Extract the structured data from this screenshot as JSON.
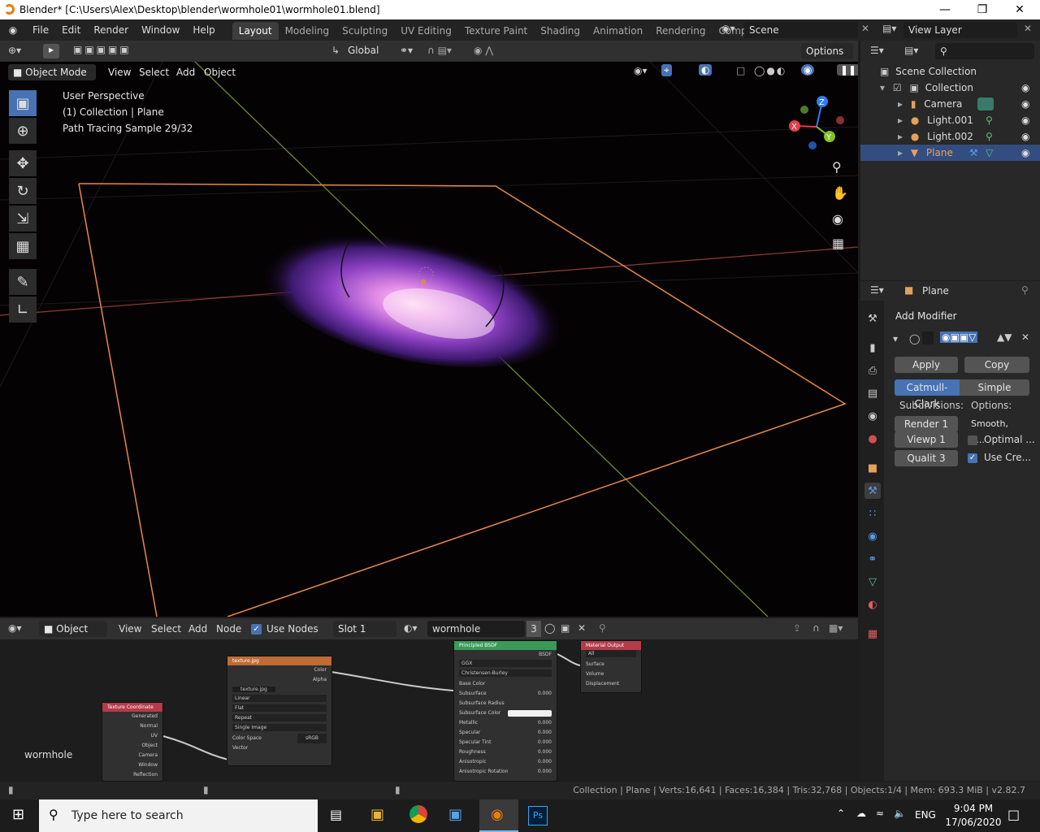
{
  "window": {
    "title": "Blender* [C:\\Users\\Alex\\Desktop\\blender\\wormhole01\\wormhole01.blend]"
  },
  "menus": [
    "File",
    "Edit",
    "Render",
    "Window",
    "Help"
  ],
  "workspaces": [
    "Layout",
    "Modeling",
    "Sculpting",
    "UV Editing",
    "Texture Paint",
    "Shading",
    "Animation",
    "Rendering",
    "Compositing"
  ],
  "scene": "Scene",
  "view_layer": "View Layer",
  "toolbar": {
    "orientation": "Global",
    "options": "Options"
  },
  "viewport_header": {
    "mode": "Object Mode",
    "view": "View",
    "select": "Select",
    "add": "Add",
    "object": "Object"
  },
  "viewport_info": {
    "line1": "User Perspective",
    "line2": "(1) Collection | Plane",
    "line3": "Path Tracing Sample 29/32"
  },
  "gizmo": {
    "x": "X",
    "y": "Y",
    "z": "Z"
  },
  "outliner": {
    "root": "Scene Collection",
    "items": [
      {
        "label": "Collection"
      },
      {
        "label": "Camera"
      },
      {
        "label": "Light.001"
      },
      {
        "label": "Light.002"
      },
      {
        "label": "Plane"
      }
    ]
  },
  "properties": {
    "object_name": "Plane",
    "add_modifier": "Add Modifier",
    "apply": "Apply",
    "copy": "Copy",
    "catmull": "Catmull-Clark",
    "simple": "Simple",
    "subdivisions": "Subdivisions:",
    "options_label": "Options:",
    "render": "Render",
    "render_val": "1",
    "viewp": "Viewp",
    "viewp_val": "1",
    "qualit": "Qualit",
    "qualit_val": "3",
    "smooth": "Smooth, k...",
    "optimal": "Optimal ...",
    "use_cre": "Use Cre..."
  },
  "node_header": {
    "object": "Object",
    "view": "View",
    "select": "Select",
    "add": "Add",
    "node": "Node",
    "use_nodes": "Use Nodes",
    "slot": "Slot 1",
    "material": "wormhole",
    "users": "3"
  },
  "nodes": {
    "tex_coord": {
      "title": "Texture Coordinate",
      "outputs": [
        "Generated",
        "Normal",
        "UV",
        "Object",
        "Camera",
        "Window",
        "Reflection"
      ]
    },
    "image": {
      "title": "texture.jpg",
      "outputs": [
        "Color",
        "Alpha"
      ],
      "file": "texture.jpg",
      "fields": [
        "Linear",
        "Flat",
        "Repeat",
        "Single Image"
      ],
      "colorspace_label": "Color Space",
      "colorspace": "sRGB",
      "vector": "Vector"
    },
    "bsdf": {
      "title": "Principled BSDF",
      "out": "BSDF",
      "fields": [
        "GGX",
        "Christensen-Burley"
      ],
      "rows": [
        {
          "label": "Base Color",
          "value": ""
        },
        {
          "label": "Subsurface",
          "value": "0.000"
        },
        {
          "label": "Subsurface Radius",
          "value": ""
        },
        {
          "label": "Subsurface Color",
          "value": ""
        },
        {
          "label": "Metallic",
          "value": "0.000"
        },
        {
          "label": "Specular",
          "value": "0.000"
        },
        {
          "label": "Specular Tint",
          "value": "0.000"
        },
        {
          "label": "Roughness",
          "value": "0.000"
        },
        {
          "label": "Anisotropic",
          "value": "0.000"
        },
        {
          "label": "Anisotropic Rotation",
          "value": "0.000"
        }
      ]
    },
    "output": {
      "title": "Material Output",
      "target": "All",
      "inputs": [
        "Surface",
        "Volume",
        "Displacement"
      ]
    }
  },
  "node_tree_label": "wormhole",
  "statusbar": {
    "text": "Collection | Plane | Verts:16,641 | Faces:16,384 | Tris:32,768 | Objects:1/4 | Mem: 693.3 MiB | v2.82.7"
  },
  "taskbar": {
    "search_placeholder": "Type here to search",
    "lang": "ENG",
    "time": "9:04 PM",
    "date": "17/06/2020"
  },
  "colors": {
    "accent": "#4772b3",
    "selection_outline": "#e8874a",
    "brand": "#e87d0d"
  }
}
